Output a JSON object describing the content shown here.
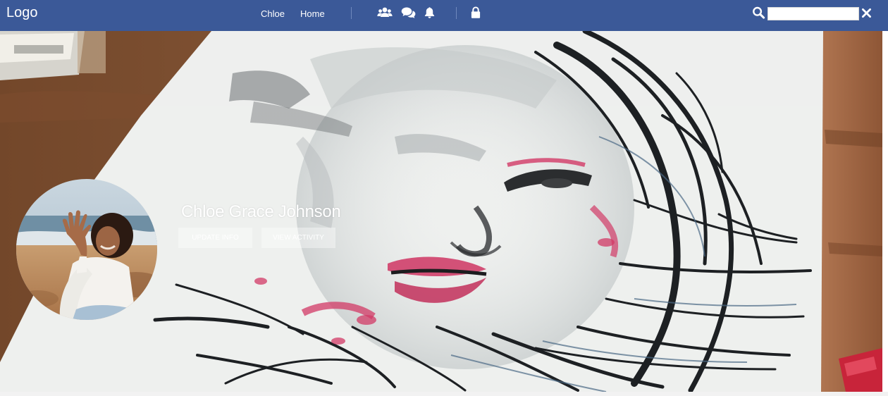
{
  "header": {
    "logo": "Logo",
    "nav_links": [
      "Chloe",
      "Home"
    ],
    "icons": [
      "users-icon",
      "chat-icon",
      "bell-icon",
      "lock-icon"
    ],
    "search": {
      "icon": "search-icon",
      "value": "",
      "placeholder": ""
    },
    "close_icon": "close-icon",
    "colors": {
      "bar": "#3b5998",
      "text": "#ffffff"
    }
  },
  "profile": {
    "name": "Chloe Grace Johnson",
    "actions": [
      "UPDATE INFO",
      "VIEW ACTIVITY"
    ]
  }
}
